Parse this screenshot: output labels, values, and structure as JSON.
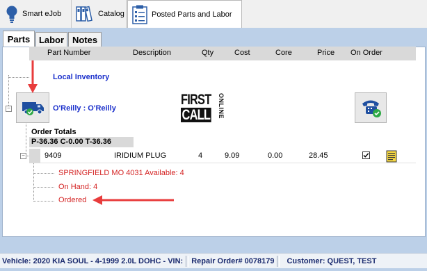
{
  "toolbar": {
    "tabs": [
      {
        "label": "Smart eJob",
        "icon": "lightbulb-icon"
      },
      {
        "label": "Catalog",
        "icon": "books-icon"
      },
      {
        "label": "Posted Parts and Labor",
        "icon": "clipboard-icon"
      }
    ]
  },
  "subtabs": [
    "Parts",
    "Labor",
    "Notes"
  ],
  "columns": [
    "Part Number",
    "Description",
    "Qty",
    "Cost",
    "Core",
    "Price",
    "On Order"
  ],
  "tree": {
    "local_inventory": "Local Inventory",
    "vendor": "O'Reilly : O'Reilly",
    "vendor_logo_text_line1": "FIRST",
    "vendor_logo_text_line2": "CALL",
    "vendor_logo_side": "ONLINE",
    "order_totals_label": "Order Totals",
    "order_totals_value": "P-36.36 C-0.00 T-36.36"
  },
  "part_row": {
    "part_number": "9409",
    "description": "IRIDIUM PLUG",
    "qty": "4",
    "cost": "9.09",
    "core": "0.00",
    "price": "28.45",
    "on_order": true
  },
  "details": [
    "SPRINGFIELD MO 4031 Available: 4",
    "On Hand: 4",
    "Ordered"
  ],
  "status_bar": {
    "vehicle": "Vehicle: 2020 KIA SOUL - 4-1999 2.0L DOHC - VIN:",
    "repair_order": "Repair Order# 0078179",
    "customer": "Customer: QUEST, TEST"
  },
  "colors": {
    "accent_blue": "#1a2fcb",
    "detail_red": "#d42424",
    "arrow_red": "#e83c3c",
    "panel_blue": "#bcd0e8"
  }
}
